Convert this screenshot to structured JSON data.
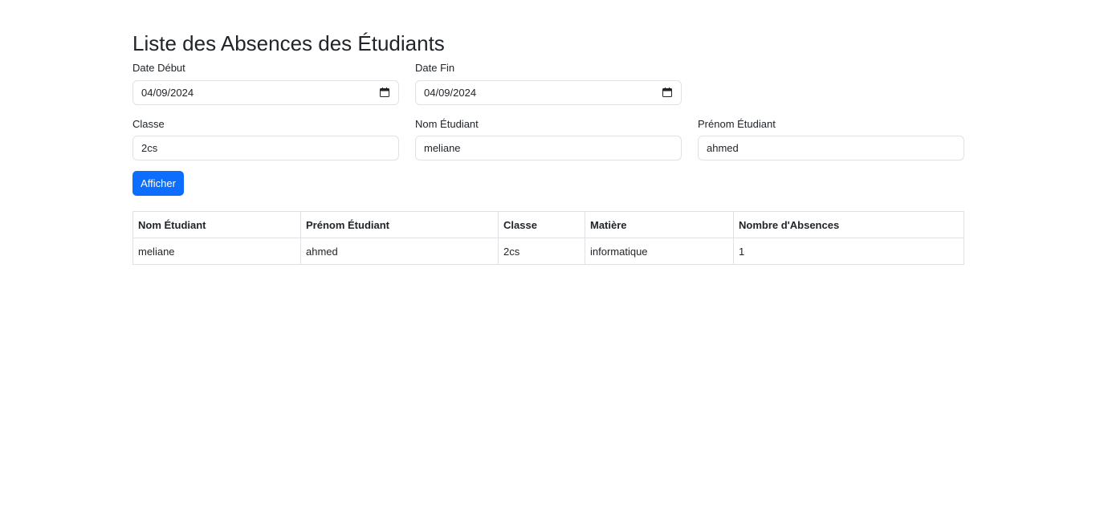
{
  "page": {
    "title": "Liste des Absences des Étudiants"
  },
  "filters": {
    "date_debut": {
      "label": "Date Début",
      "value": "04/09/2024"
    },
    "date_fin": {
      "label": "Date Fin",
      "value": "04/09/2024"
    },
    "classe": {
      "label": "Classe",
      "value": "2cs"
    },
    "nom": {
      "label": "Nom Étudiant",
      "value": "meliane"
    },
    "prenom": {
      "label": "Prénom Étudiant",
      "value": "ahmed"
    }
  },
  "submit_button": {
    "label": "Afficher",
    "color": "#0d6efd"
  },
  "calendar_icon": "calendar-icon",
  "table": {
    "headers": [
      "Nom Étudiant",
      "Prénom Étudiant",
      "Classe",
      "Matière",
      "Nombre d'Absences"
    ],
    "rows": [
      [
        "meliane",
        "ahmed",
        "2cs",
        "informatique",
        "1"
      ]
    ]
  }
}
